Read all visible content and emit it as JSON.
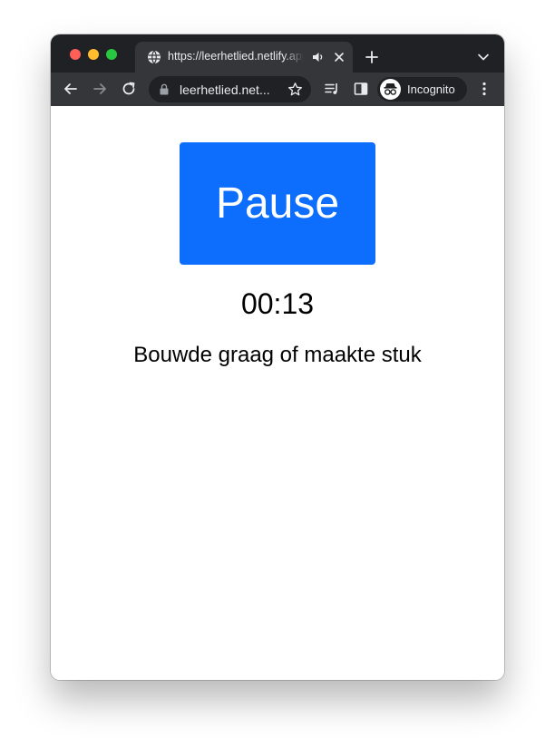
{
  "browser": {
    "tab": {
      "title": "https://leerhetlied.netlify.app/",
      "favicon": "globe-icon",
      "audio_icon": "speaker-icon",
      "close_icon": "close-icon"
    },
    "new_tab_icon": "plus-icon",
    "tab_search_icon": "chevron-down-icon",
    "toolbar": {
      "back_icon": "arrow-left-icon",
      "forward_icon": "arrow-right-icon",
      "reload_icon": "reload-icon",
      "url": "leerhetlied.net...",
      "lock_icon": "lock-icon",
      "bookmark_icon": "star-icon",
      "media_icon": "playlist-icon",
      "side_panel_icon": "side-panel-icon",
      "profile_label": "Incognito",
      "profile_icon": "incognito-icon",
      "menu_icon": "kebab-menu-icon"
    },
    "colors": {
      "tabstrip_bg": "#202124",
      "toolbar_bg": "#35363a",
      "text": "#e8eaed"
    }
  },
  "page": {
    "pause_label": "Pause",
    "timer": "00:13",
    "lyric_line": "Bouwde graag of maakte stuk",
    "colors": {
      "button_bg": "#0d6efd",
      "button_text": "#ffffff"
    }
  }
}
